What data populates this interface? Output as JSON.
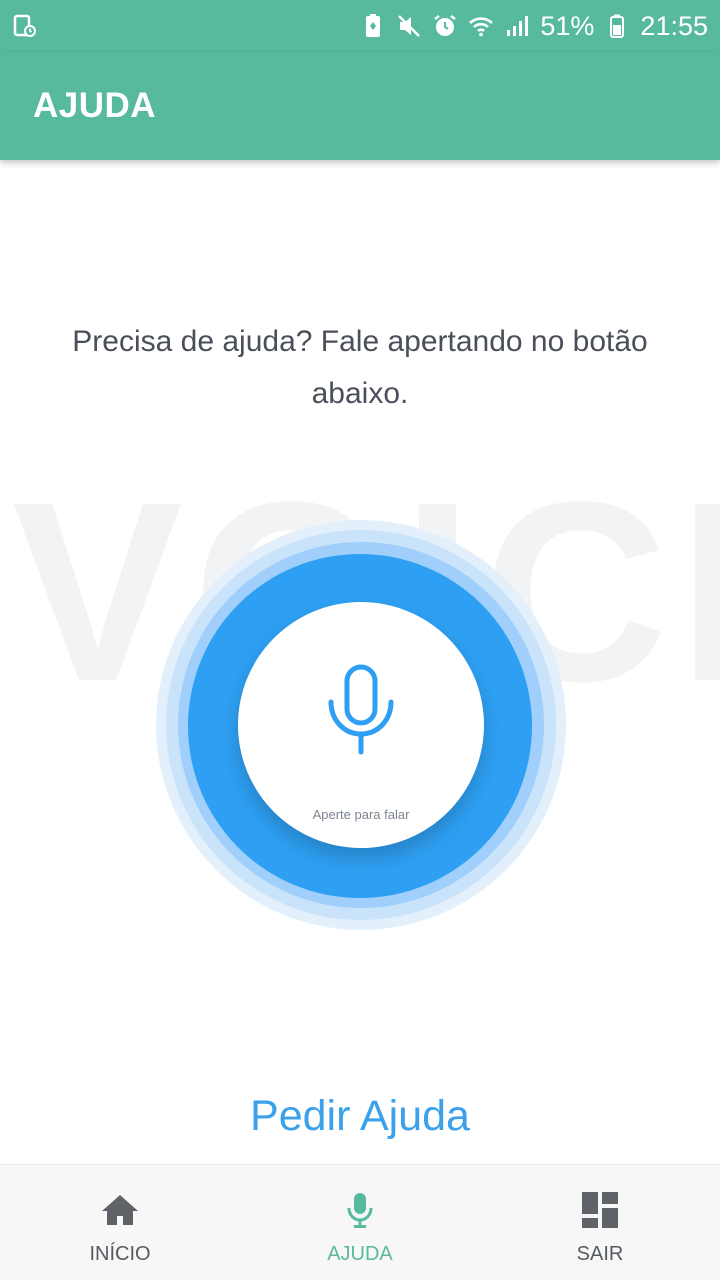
{
  "status_bar": {
    "battery_percent": "51%",
    "time": "21:55",
    "icons": [
      "screen-record-icon",
      "battery-saver-icon",
      "mute-icon",
      "alarm-icon",
      "wifi-icon",
      "signal-icon",
      "battery-icon"
    ]
  },
  "app_bar": {
    "title": "AJUDA"
  },
  "content": {
    "prompt": "Precisa de ajuda? Fale apertando no botão abaixo.",
    "watermark": "VOICE",
    "mic_hint": "Aperte para falar",
    "cta": "Pedir Ajuda"
  },
  "bottom_nav": {
    "items": [
      {
        "label": "INÍCIO",
        "icon": "home-icon",
        "active": false
      },
      {
        "label": "AJUDA",
        "icon": "microphone-icon",
        "active": true
      },
      {
        "label": "SAIR",
        "icon": "dashboard-icon",
        "active": false
      }
    ]
  },
  "colors": {
    "primary": "#57ba9f",
    "accent_blue": "#2e9ff2",
    "cta_blue": "#3aa1ea",
    "text_gray": "#4a4f5a"
  }
}
